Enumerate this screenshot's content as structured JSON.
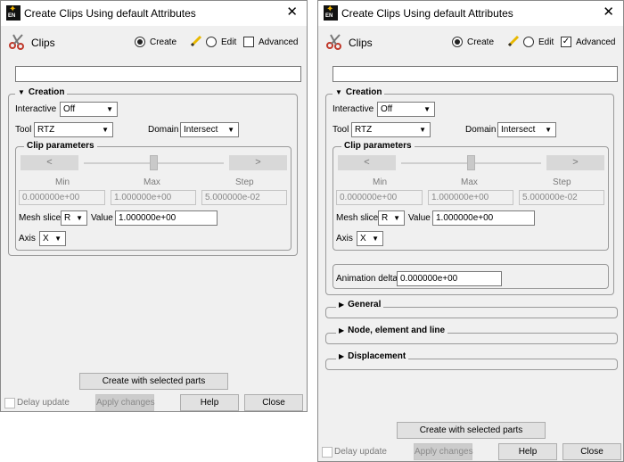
{
  "windows": [
    {
      "title": "Create Clips Using default Attributes",
      "header_label": "Clips",
      "mode_create": "Create",
      "mode_edit": "Edit",
      "advanced_label": "Advanced",
      "advanced_checked": "",
      "name_value": "",
      "creation_legend": "Creation",
      "interactive_label": "Interactive",
      "interactive_value": "Off",
      "tool_label": "Tool",
      "tool_value": "RTZ",
      "domain_label": "Domain",
      "domain_value": "Intersect",
      "clip_params_legend": "Clip parameters",
      "slider_left": "<",
      "slider_right": ">",
      "min_label": "Min",
      "max_label": "Max",
      "step_label": "Step",
      "min_value": "0.000000e+00",
      "max_value": "1.000000e+00",
      "step_value": "5.000000e-02",
      "mesh_slice_label": "Mesh slice",
      "mesh_slice_value": "R",
      "value_label": "Value",
      "value_value": "1.000000e+00",
      "axis_label": "Axis",
      "axis_value": "X",
      "create_button": "Create with selected parts",
      "delay_update": "Delay update",
      "apply_changes": "Apply changes",
      "help": "Help",
      "close": "Close"
    },
    {
      "title": "Create Clips Using default Attributes",
      "header_label": "Clips",
      "mode_create": "Create",
      "mode_edit": "Edit",
      "advanced_label": "Advanced",
      "advanced_checked": "✓",
      "name_value": "",
      "creation_legend": "Creation",
      "interactive_label": "Interactive",
      "interactive_value": "Off",
      "tool_label": "Tool",
      "tool_value": "RTZ",
      "domain_label": "Domain",
      "domain_value": "Intersect",
      "clip_params_legend": "Clip parameters",
      "slider_left": "<",
      "slider_right": ">",
      "min_label": "Min",
      "max_label": "Max",
      "step_label": "Step",
      "min_value": "0.000000e+00",
      "max_value": "1.000000e+00",
      "step_value": "5.000000e-02",
      "mesh_slice_label": "Mesh slice",
      "mesh_slice_value": "R",
      "value_label": "Value",
      "value_value": "1.000000e+00",
      "axis_label": "Axis",
      "axis_value": "X",
      "animation_delta_label": "Animation delta",
      "animation_delta_value": "0.000000e+00",
      "general_label": "General",
      "node_element_line_label": "Node, element and line",
      "displacement_label": "Displacement",
      "create_button": "Create with selected parts",
      "delay_update": "Delay update",
      "apply_changes": "Apply changes",
      "help": "Help",
      "close": "Close"
    }
  ],
  "colors": {
    "accent_scissors": "#c0392b",
    "pencil": "#e8b800",
    "window_bg": "#f0f0f0"
  },
  "icons": {
    "app": "ensight-app-icon",
    "close": "close-icon",
    "clips": "scissors-icon",
    "edit": "pencil-icon",
    "collapse": "triangle-down-icon",
    "expand": "triangle-right-icon",
    "dropdown": "chevron-down-icon"
  }
}
